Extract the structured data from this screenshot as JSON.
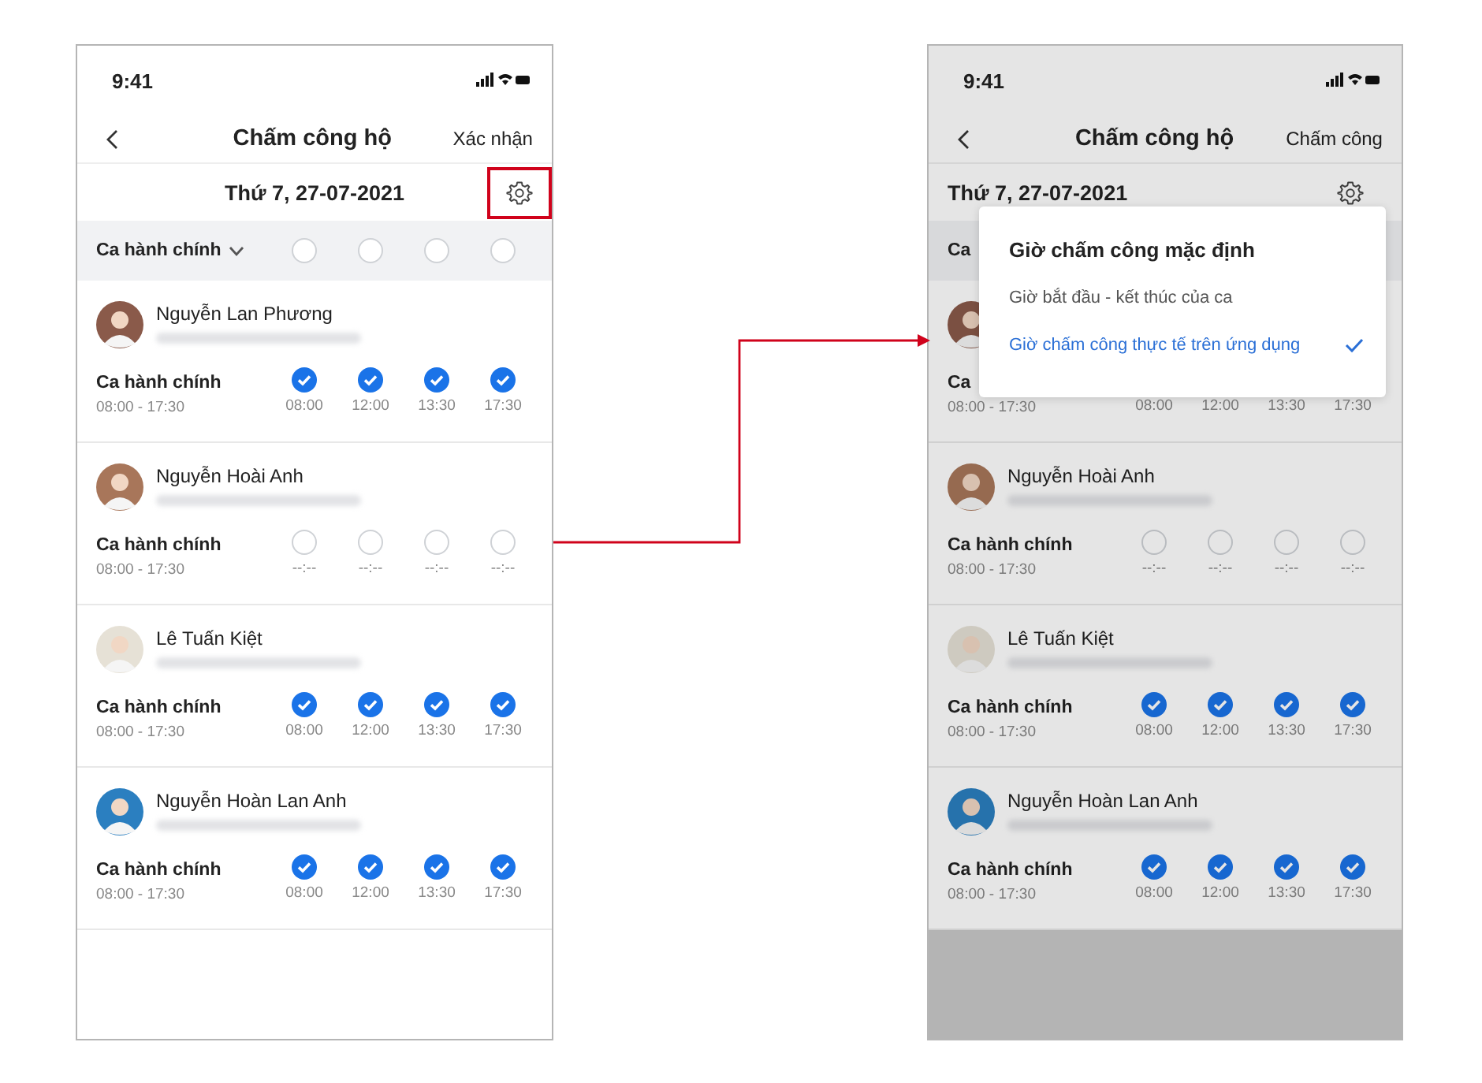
{
  "screens": [
    {
      "kind": "main",
      "status_time": "9:41",
      "title": "Chấm công hộ",
      "action": "Xác nhận",
      "date": "Thứ 7, 27-07-2021",
      "gear_highlighted": true,
      "group": {
        "label": "Ca hành chính",
        "has_chevron": true,
        "slots": [
          {
            "checked": false
          },
          {
            "checked": false
          },
          {
            "checked": false
          },
          {
            "checked": false
          }
        ]
      },
      "employees": [
        {
          "name": "Nguyễn Lan Phương",
          "shift": "Ca hành chính",
          "hours": "08:00 - 17:30",
          "slots": [
            {
              "checked": true,
              "time": "08:00"
            },
            {
              "checked": true,
              "time": "12:00"
            },
            {
              "checked": true,
              "time": "13:30"
            },
            {
              "checked": true,
              "time": "17:30"
            }
          ]
        },
        {
          "name": "Nguyễn Hoài Anh",
          "shift": "Ca hành chính",
          "hours": "08:00 - 17:30",
          "slots": [
            {
              "checked": false,
              "time": "--:--"
            },
            {
              "checked": false,
              "time": "--:--"
            },
            {
              "checked": false,
              "time": "--:--"
            },
            {
              "checked": false,
              "time": "--:--"
            }
          ]
        },
        {
          "name": "Lê Tuấn Kiệt",
          "shift": "Ca hành chính",
          "hours": "08:00 - 17:30",
          "slots": [
            {
              "checked": true,
              "time": "08:00"
            },
            {
              "checked": true,
              "time": "12:00"
            },
            {
              "checked": true,
              "time": "13:30"
            },
            {
              "checked": true,
              "time": "17:30"
            }
          ]
        },
        {
          "name": "Nguyễn Hoàn Lan Anh",
          "shift": "Ca hành chính",
          "hours": "08:00 - 17:30",
          "slots": [
            {
              "checked": true,
              "time": "08:00"
            },
            {
              "checked": true,
              "time": "12:00"
            },
            {
              "checked": true,
              "time": "13:30"
            },
            {
              "checked": true,
              "time": "17:30"
            }
          ]
        }
      ]
    },
    {
      "kind": "dimmed",
      "status_time": "9:41",
      "title": "Chấm công hộ",
      "action": "Chấm công",
      "date": "Thứ 7, 27-07-2021",
      "gear_highlighted": false,
      "group": {
        "label": "Ca"
      },
      "employees": [
        {
          "shift": "Ca",
          "hours": "08:00 - 17:30",
          "slots": [
            {
              "time": "08:00"
            },
            {
              "time": "12:00"
            },
            {
              "time": "13:30"
            },
            {
              "time": "17:30"
            }
          ]
        },
        {
          "name": "Nguyễn Hoài Anh",
          "shift": "Ca hành chính",
          "hours": "08:00 - 17:30",
          "slots": [
            {
              "checked": false,
              "time": "--:--"
            },
            {
              "checked": false,
              "time": "--:--"
            },
            {
              "checked": false,
              "time": "--:--"
            },
            {
              "checked": false,
              "time": "--:--"
            }
          ]
        },
        {
          "name": "Lê Tuấn Kiệt",
          "shift": "Ca hành chính",
          "hours": "08:00 - 17:30",
          "slots": [
            {
              "checked": true,
              "time": "08:00"
            },
            {
              "checked": true,
              "time": "12:00"
            },
            {
              "checked": true,
              "time": "13:30"
            },
            {
              "checked": true,
              "time": "17:30"
            }
          ]
        },
        {
          "name": "Nguyễn Hoàn Lan Anh",
          "shift": "Ca hành chính",
          "hours": "08:00 - 17:30",
          "slots": [
            {
              "checked": true,
              "time": "08:00"
            },
            {
              "checked": true,
              "time": "12:00"
            },
            {
              "checked": true,
              "time": "13:30"
            },
            {
              "checked": true,
              "time": "17:30"
            }
          ]
        }
      ],
      "popup": {
        "title": "Giờ chấm công mặc định",
        "options": [
          {
            "label": "Giờ bắt đầu - kết thúc của ca",
            "selected": false
          },
          {
            "label": "Giờ chấm công thực tế trên ứng dụng",
            "selected": true
          }
        ]
      }
    }
  ]
}
